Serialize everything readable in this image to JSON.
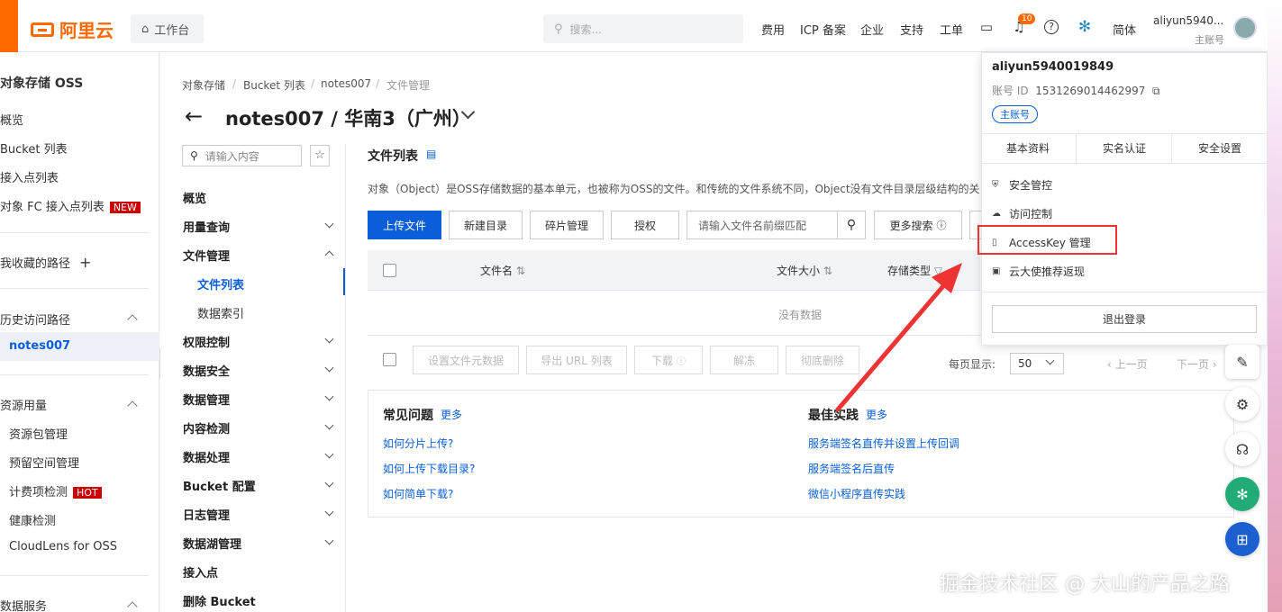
{
  "topbar": {
    "logo": "阿里云",
    "workbench": "工作台",
    "search_placeholder": "搜索...",
    "nav": [
      "费用",
      "ICP 备案",
      "企业",
      "支持",
      "工单"
    ],
    "notification_count": "10",
    "language": "简体",
    "username": "aliyun5940...",
    "role": "主账号"
  },
  "sidebar": {
    "title": "对象存储 OSS",
    "items": [
      "概览",
      "Bucket 列表",
      "接入点列表",
      "对象 FC 接入点列表"
    ],
    "new_tag": "NEW",
    "favorites": "我收藏的路径",
    "history_header": "历史访问路径",
    "history_item": "notes007",
    "resource_header": "资源用量",
    "resource_items": [
      "资源包管理",
      "预留空间管理",
      "计费项检测",
      "健康检测",
      "CloudLens for OSS"
    ],
    "hot_tag": "HOT",
    "data_service": "数据服务"
  },
  "breadcrumb": [
    "对象存储",
    "Bucket 列表",
    "notes007",
    "文件管理"
  ],
  "bucket_title": "notes007 / 华南3（广州）",
  "menu": {
    "search_placeholder": "请输入内容",
    "items": [
      "概览",
      "用量查询",
      "文件管理",
      "文件列表",
      "数据索引",
      "权限控制",
      "数据安全",
      "数据管理",
      "内容检测",
      "数据处理",
      "Bucket 配置",
      "日志管理",
      "数据湖管理",
      "接入点",
      "删除 Bucket"
    ]
  },
  "file_list": {
    "title": "文件列表",
    "description": "对象（Object）是OSS存储数据的基本单元，也被称为OSS的文件。和传统的文件系统不同，Object没有文件目录层级结构的关系",
    "buttons": [
      "上传文件",
      "新建目录",
      "碎片管理",
      "授权"
    ],
    "prefix_placeholder": "请输入文件名前缀匹配",
    "more_search": "更多搜索",
    "columns": [
      "文件名",
      "文件大小",
      "存储类型"
    ],
    "empty": "没有数据",
    "bulk_buttons": [
      "设置文件元数据",
      "导出 URL 列表",
      "下载",
      "解冻",
      "彻底删除"
    ],
    "per_page_label": "每页显示:",
    "per_page": "50",
    "prev": "上一页",
    "next": "下一页"
  },
  "faq": {
    "title": "常见问题",
    "more": "更多",
    "links": [
      "如何分片上传?",
      "如何上传下载目录?",
      "如何简单下载?"
    ]
  },
  "best": {
    "title": "最佳实践",
    "more": "更多",
    "links": [
      "服务端签名直传并设置上传回调",
      "服务端签名后直传",
      "微信小程序直传实践"
    ]
  },
  "dropdown": {
    "account_name": "aliyun5940019849",
    "id_label": "账号 ID",
    "id_value": "1531269014462997",
    "role": "主账号",
    "tabs": [
      "基本资料",
      "实名认证",
      "安全设置"
    ],
    "items": [
      "安全管控",
      "访问控制",
      "AccessKey 管理",
      "云大使推荐返现"
    ],
    "logout": "退出登录"
  },
  "watermark": "掘金技术社区 @ 大山的产品之路",
  "colors": {
    "brand": "#ff6a00",
    "primary": "#0b5ed7",
    "highlight": "#e33"
  }
}
